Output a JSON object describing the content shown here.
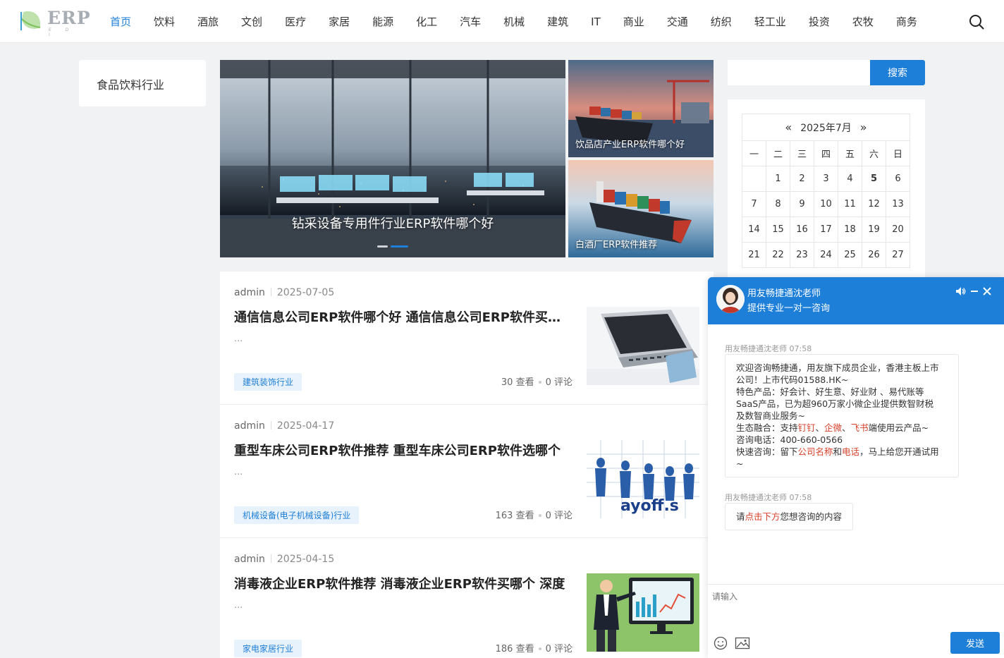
{
  "header": {
    "logo_text": "ERP",
    "logo_sub": "E D I",
    "nav": [
      {
        "label": "首页",
        "active": true
      },
      {
        "label": "饮料"
      },
      {
        "label": "酒旅"
      },
      {
        "label": "文创"
      },
      {
        "label": "医疗"
      },
      {
        "label": "家居"
      },
      {
        "label": "能源"
      },
      {
        "label": "化工"
      },
      {
        "label": "汽车"
      },
      {
        "label": "机械"
      },
      {
        "label": "建筑"
      },
      {
        "label": "IT"
      },
      {
        "label": "商业"
      },
      {
        "label": "交通"
      },
      {
        "label": "纺织"
      },
      {
        "label": "轻工业"
      },
      {
        "label": "投资"
      },
      {
        "label": "农牧"
      },
      {
        "label": "商务"
      }
    ],
    "search_icon": "search-icon"
  },
  "category": {
    "label": "食品饮料行业"
  },
  "slider": {
    "caption": "钻采设备专用件行业ERP软件哪个好",
    "active_slide": 2,
    "slide_count": 2,
    "side_cards": [
      {
        "caption": "饮品店产业ERP软件哪个好"
      },
      {
        "caption": "白酒厂ERP软件推荐"
      }
    ]
  },
  "posts": [
    {
      "author": "admin",
      "date": "2025-07-05",
      "title": "通信信息公司ERP软件哪个好 通信信息公司ERP软件买哪个",
      "excerpt": "...",
      "tag": "建筑装饰行业",
      "views": "30 查看",
      "comments": "0 评论"
    },
    {
      "author": "admin",
      "date": "2025-04-17",
      "title": "重型车床公司ERP软件推荐 重型车床公司ERP软件选哪个",
      "excerpt": "...",
      "tag": "机械设备(电子机械设备)行业",
      "views": "163 查看",
      "comments": "0 评论"
    },
    {
      "author": "admin",
      "date": "2025-04-15",
      "title": "消毒液企业ERP软件推荐 消毒液企业ERP软件买哪个 深度",
      "excerpt": "...",
      "tag": "家电家居行业",
      "views": "186 查看",
      "comments": "0 评论"
    }
  ],
  "sidebar": {
    "search_placeholder": "",
    "search_button": "搜索",
    "calendar": {
      "title": "2025年7月",
      "prev": "«",
      "next": "»",
      "weekdays": [
        "一",
        "二",
        "三",
        "四",
        "五",
        "六",
        "日"
      ],
      "weeks": [
        [
          "",
          "1",
          "2",
          "3",
          "4",
          "5",
          "6"
        ],
        [
          "7",
          "8",
          "9",
          "10",
          "11",
          "12",
          "13"
        ],
        [
          "14",
          "15",
          "16",
          "17",
          "18",
          "19",
          "20"
        ],
        [
          "21",
          "22",
          "23",
          "24",
          "25",
          "26",
          "27"
        ]
      ],
      "today": "5"
    }
  },
  "chat": {
    "agent_name": "用友畅捷通沈老师",
    "slogan": "提供专业一对一咨询",
    "messages": [
      {
        "meta": "用友畅捷通沈老师 07:58",
        "lines": [
          [
            {
              "t": "欢迎咨询畅捷通，用友旗下成员企业，香港主板上市"
            }
          ],
          [
            {
              "t": "公司！上市代码01588.HK~"
            }
          ],
          [
            {
              "t": "特色产品：好会计、好生意、好业财 、易代账等"
            }
          ],
          [
            {
              "t": "SaaS产品，已为超960万家小微企业提供数智财税"
            }
          ],
          [
            {
              "t": "及数智商业服务~"
            }
          ],
          [
            {
              "t": "生态融合：支持"
            },
            {
              "t": "钉钉",
              "hl": true
            },
            {
              "t": "、"
            },
            {
              "t": "企微",
              "hl": true
            },
            {
              "t": "、"
            },
            {
              "t": "飞书",
              "hl": true
            },
            {
              "t": "端使用云产品~"
            }
          ],
          [
            {
              "t": "咨询电话：400-660-0566"
            }
          ],
          [
            {
              "t": "快速咨询：留下"
            },
            {
              "t": "公司名称",
              "hl": true
            },
            {
              "t": "和"
            },
            {
              "t": "电话",
              "hl": true
            },
            {
              "t": "，马上给您开通试用"
            }
          ],
          [
            {
              "t": "~"
            }
          ]
        ]
      },
      {
        "meta": "用友畅捷通沈老师 07:58",
        "lines": [
          [
            {
              "t": "请"
            },
            {
              "t": "点击下方",
              "hl": true
            },
            {
              "t": "您想咨询的内容"
            }
          ]
        ]
      }
    ],
    "input_placeholder": "请输入",
    "send_button": "发送"
  }
}
